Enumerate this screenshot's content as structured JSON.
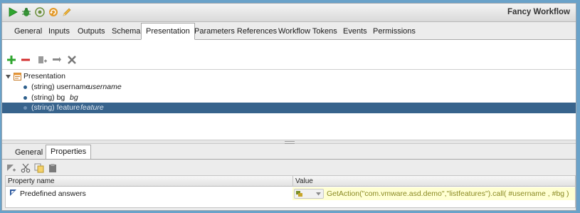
{
  "window": {
    "title": "Fancy Workflow",
    "toolbar_icons": [
      "run-icon",
      "debug-icon",
      "validate-icon",
      "refresh-icon",
      "edit-icon"
    ]
  },
  "tabs": [
    {
      "label": "General"
    },
    {
      "label": "Inputs"
    },
    {
      "label": "Outputs"
    },
    {
      "label": "Schema"
    },
    {
      "label": "Presentation",
      "active": true
    },
    {
      "label": "Parameters References"
    },
    {
      "label": "Workflow Tokens"
    },
    {
      "label": "Events"
    },
    {
      "label": "Permissions"
    }
  ],
  "presentation_toolbar": [
    "add-icon",
    "remove-icon",
    "add-step-icon",
    "move-icon",
    "delete-icon"
  ],
  "tree": {
    "root": "Presentation",
    "items": [
      {
        "type": "(string) username",
        "name": "username"
      },
      {
        "type": "(string) bg",
        "name": "bg"
      },
      {
        "type": "(string) feature",
        "name": "feature",
        "selected": true
      }
    ]
  },
  "bottom_tabs": [
    {
      "label": "General"
    },
    {
      "label": "Properties",
      "active": true
    }
  ],
  "properties_toolbar": [
    "add-property-icon",
    "cut-icon",
    "copy-icon",
    "paste-icon"
  ],
  "properties_table": {
    "headers": [
      "Property name",
      "Value"
    ],
    "rows": [
      {
        "name": "Predefined answers",
        "value": "GetAction(\"com.vmware.asd.demo\",\"listfeatures\").call( #username , #bg )"
      }
    ]
  },
  "colors": {
    "selection": "#37638c",
    "value_background": "#ffffd2",
    "accent_green": "#2fa52f",
    "accent_red": "#d32f2f"
  }
}
